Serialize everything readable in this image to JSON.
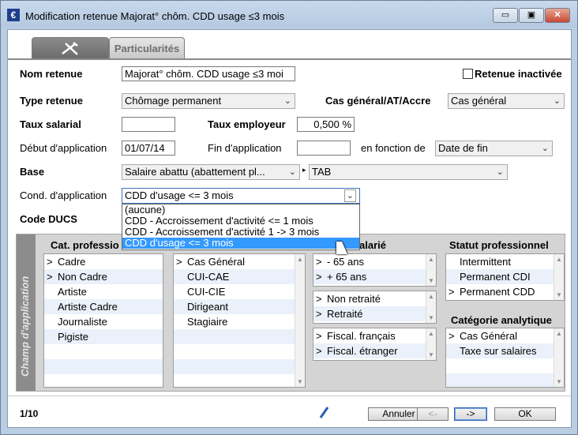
{
  "window": {
    "title": "Modification retenue Majorat° chôm. CDD usage ≤3 mois",
    "app_icon": "€",
    "minimize": "▭",
    "maximize": "▣",
    "close": "✕"
  },
  "tabs": [
    {
      "label": "",
      "icon": "tools-icon"
    },
    {
      "label": "Particularités"
    }
  ],
  "form": {
    "nom_retenue_label": "Nom retenue",
    "nom_retenue_value": "Majorat° chôm. CDD usage ≤3 moi",
    "retenue_inactivee_label": "Retenue inactivée",
    "type_retenue_label": "Type retenue",
    "type_retenue_value": "Chômage permanent",
    "cas_general_label": "Cas général/AT/Accre",
    "cas_general_value": "Cas général",
    "taux_salarial_label": "Taux salarial",
    "taux_salarial_value": "",
    "taux_employeur_label": "Taux employeur",
    "taux_employeur_value": "0,500 %",
    "debut_label": "Début d'application",
    "debut_value": "01/07/14",
    "fin_label": "Fin d'application",
    "fin_value": "",
    "en_fonction_label": "en fonction de",
    "en_fonction_value": "Date de fin",
    "base_label": "Base",
    "base_value": "Salaire abattu (abattement pl...",
    "base2_value": "TAB",
    "cond_label": "Cond. d'application",
    "cond_value": "CDD d'usage <= 3 mois",
    "code_ducs_label": "Code DUCS",
    "dropdown_options": [
      "(aucune)",
      "CDD - Accroissement d'activité <= 1 mois",
      "CDD - Accroissement d'activité 1 -> 3 mois",
      "CDD d'usage <= 3 mois"
    ]
  },
  "champ": {
    "vertical_label": "Champ d'application",
    "col1_head": "Cat. professio",
    "col1_items": [
      {
        "mark": ">",
        "label": "Cadre"
      },
      {
        "mark": ">",
        "label": "Non Cadre"
      },
      {
        "mark": "",
        "label": "Artiste"
      },
      {
        "mark": "",
        "label": "Artiste Cadre"
      },
      {
        "mark": "",
        "label": "Journaliste"
      },
      {
        "mark": "",
        "label": "Pigiste"
      },
      {
        "mark": "",
        "label": ""
      },
      {
        "mark": "",
        "label": ""
      }
    ],
    "col2_items": [
      {
        "mark": ">",
        "label": "Cas Général"
      },
      {
        "mark": "",
        "label": "CUI-CAE"
      },
      {
        "mark": "",
        "label": "CUI-CIE"
      },
      {
        "mark": "",
        "label": "Dirigeant"
      },
      {
        "mark": "",
        "label": "Stagiaire"
      },
      {
        "mark": "",
        "label": ""
      },
      {
        "mark": "",
        "label": ""
      },
      {
        "mark": "",
        "label": ""
      }
    ],
    "col3_head": "alarié",
    "col3a_items": [
      {
        "mark": ">",
        "label": "- 65 ans"
      },
      {
        "mark": ">",
        "label": "+ 65 ans"
      }
    ],
    "col3b_items": [
      {
        "mark": ">",
        "label": "Non retraité"
      },
      {
        "mark": ">",
        "label": "Retraité"
      }
    ],
    "col3c_items": [
      {
        "mark": ">",
        "label": "Fiscal. français"
      },
      {
        "mark": ">",
        "label": "Fiscal. étranger"
      }
    ],
    "col4_head": "Statut professionnel",
    "col4_items": [
      {
        "mark": "",
        "label": "Intermittent"
      },
      {
        "mark": "",
        "label": "Permanent CDI"
      },
      {
        "mark": ">",
        "label": "Permanent CDD"
      }
    ],
    "col5_head": "Catégorie analytique",
    "col5_items": [
      {
        "mark": ">",
        "label": "Cas Général"
      },
      {
        "mark": "",
        "label": "Taxe sur salaires"
      },
      {
        "mark": "",
        "label": ""
      },
      {
        "mark": "",
        "label": ""
      }
    ]
  },
  "footer": {
    "record_counter": "1/10",
    "cancel_label": "Annuler",
    "prev_label": "<-",
    "next_label": "->",
    "ok_label": "OK"
  }
}
